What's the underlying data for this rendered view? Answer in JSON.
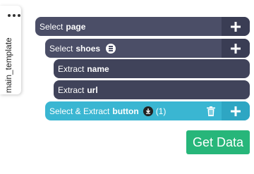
{
  "sidebar": {
    "tab_label": "main_template"
  },
  "tree": {
    "page": {
      "action": "Select",
      "name": "page"
    },
    "shoes": {
      "action": "Select",
      "name": "shoes"
    },
    "name": {
      "action": "Extract",
      "name": "name"
    },
    "url": {
      "action": "Extract",
      "name": "url"
    },
    "button": {
      "action": "Select & Extract",
      "name": "button",
      "count": "(1)"
    }
  },
  "actions": {
    "get_data_label": "Get Data"
  },
  "colors": {
    "node_dark": "#4b4e67",
    "node_highlight": "#3ab6d2",
    "get_data": "#27b67a"
  },
  "icons": {
    "menu": "more-horizontal-icon",
    "plus": "plus-icon",
    "list": "list-icon",
    "download": "download-icon",
    "trash": "trash-icon"
  }
}
